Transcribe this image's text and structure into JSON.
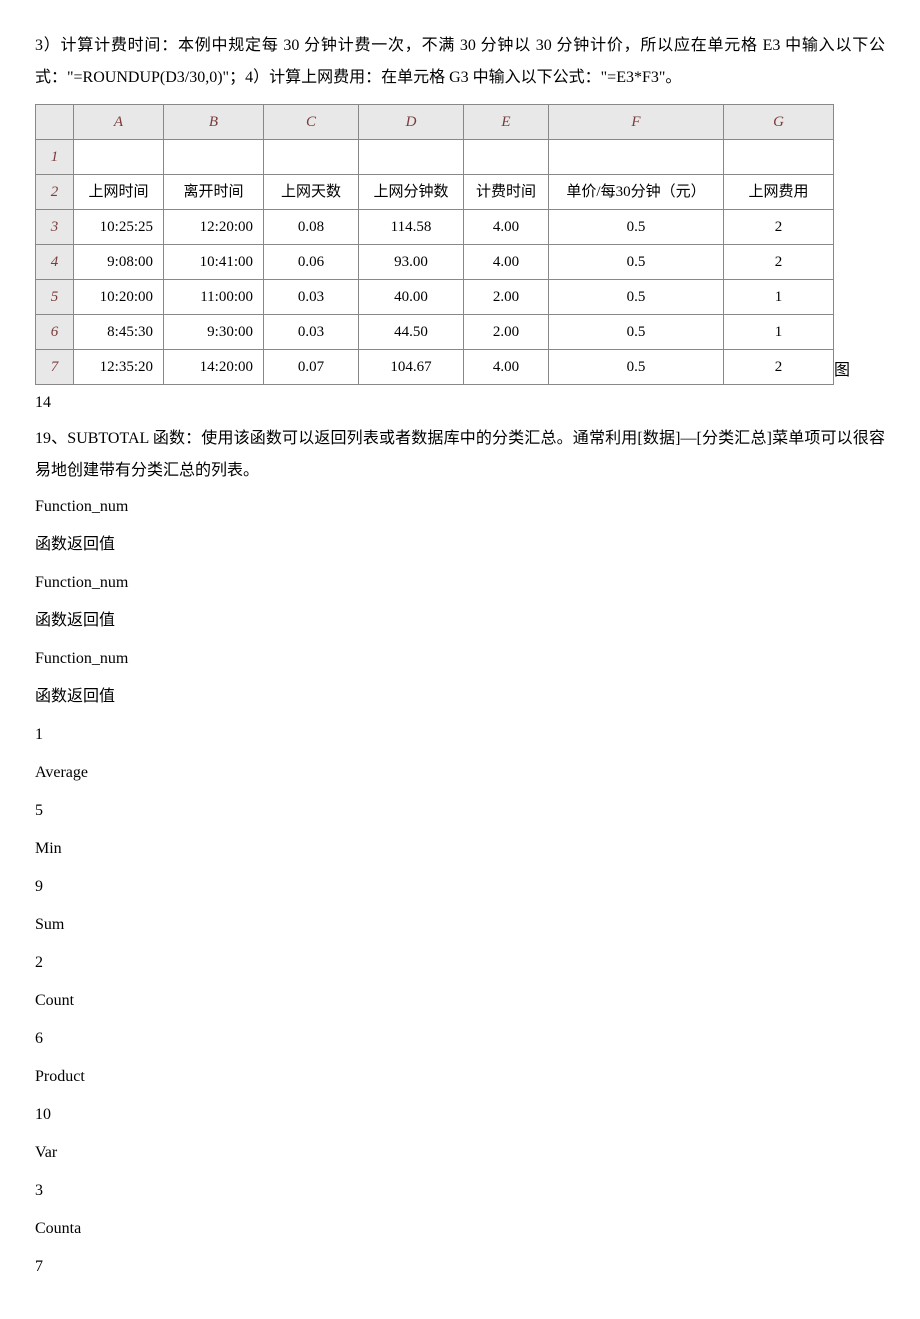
{
  "para1": "3）计算计费时间：本例中规定每 30 分钟计费一次，不满 30 分钟以 30 分钟计价，所以应在单元格 E3 中输入以下公式：\"=ROUNDUP(D3/30,0)\"；4）计算上网费用：在单元格 G3 中输入以下公式：\"=E3*F3\"。",
  "figlabel": "图",
  "fignum": "14",
  "table": {
    "cols": [
      "A",
      "B",
      "C",
      "D",
      "E",
      "F",
      "G"
    ],
    "rownums": [
      "1",
      "2",
      "3",
      "4",
      "5",
      "6",
      "7"
    ],
    "rows": [
      [
        "",
        "",
        "",
        "",
        "",
        "",
        ""
      ],
      [
        "上网时间",
        "离开时间",
        "上网天数",
        "上网分钟数",
        "计费时间",
        "单价/每30分钟（元）",
        "上网费用"
      ],
      [
        "10:25:25",
        "12:20:00",
        "0.08",
        "114.58",
        "4.00",
        "0.5",
        "2"
      ],
      [
        "9:08:00",
        "10:41:00",
        "0.06",
        "93.00",
        "4.00",
        "0.5",
        "2"
      ],
      [
        "10:20:00",
        "11:00:00",
        "0.03",
        "40.00",
        "2.00",
        "0.5",
        "1"
      ],
      [
        "8:45:30",
        "9:30:00",
        "0.03",
        "44.50",
        "2.00",
        "0.5",
        "1"
      ],
      [
        "12:35:20",
        "14:20:00",
        "0.07",
        "104.67",
        "4.00",
        "0.5",
        "2"
      ]
    ]
  },
  "para2": "19、SUBTOTAL 函数：使用该函数可以返回列表或者数据库中的分类汇总。通常利用[数据]—[分类汇总]菜单项可以很容易地创建带有分类汇总的列表。",
  "list": [
    "Function_num",
    "函数返回值",
    "Function_num",
    "函数返回值",
    "Function_num",
    "函数返回值",
    "1",
    "Average",
    "5",
    "Min",
    "9",
    "Sum",
    "2",
    "Count",
    "6",
    "Product",
    "10",
    "Var",
    "3",
    "Counta",
    "7"
  ]
}
